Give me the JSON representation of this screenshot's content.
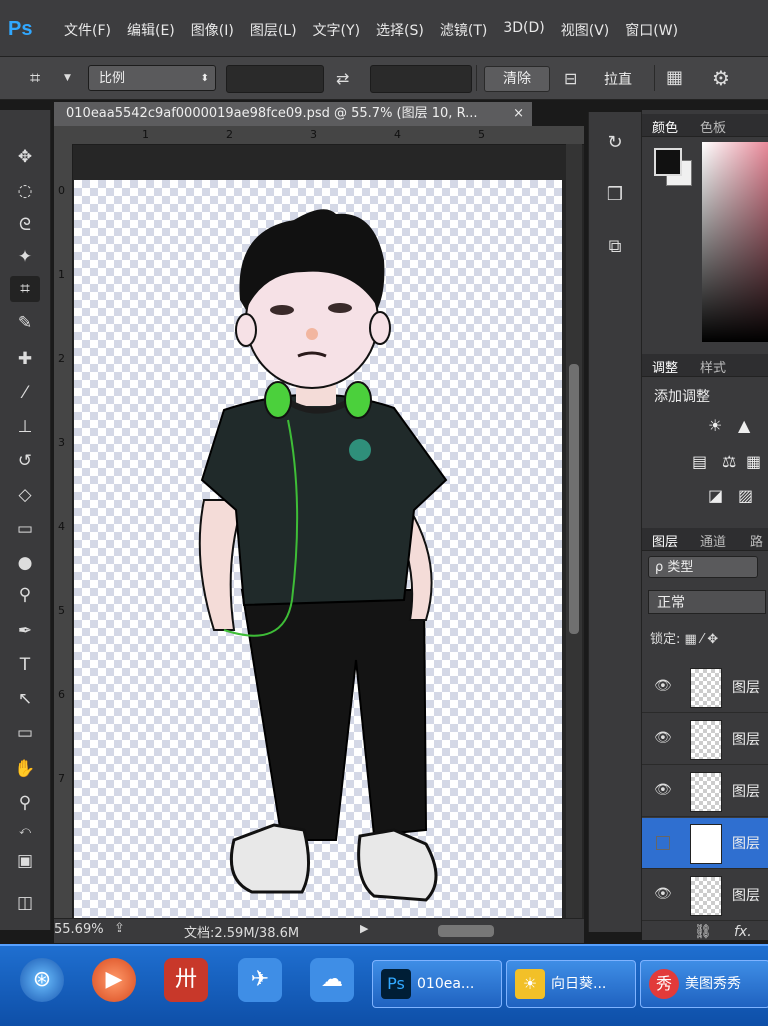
{
  "app": {
    "logo": "Ps"
  },
  "menu": [
    "文件(F)",
    "编辑(E)",
    "图像(I)",
    "图层(L)",
    "文字(Y)",
    "选择(S)",
    "滤镜(T)",
    "3D(D)",
    "视图(V)",
    "窗口(W)"
  ],
  "options": {
    "ratio_label": "比例",
    "clear_label": "清除",
    "straighten_label": "拉直",
    "icons": [
      "crop-icon",
      "swap-icon",
      "straighten-icon",
      "grid-overlay-icon",
      "gear-icon"
    ]
  },
  "document": {
    "tab_title": "010eaa5542c9af0000019ae98fce09.psd @ 55.7% (图层 10, R...",
    "close_glyph": "×",
    "ruler_h": [
      "1",
      "2",
      "3",
      "4",
      "5"
    ],
    "ruler_v": [
      "0",
      "1",
      "2",
      "3",
      "4",
      "5",
      "6",
      "7"
    ]
  },
  "status": {
    "zoom": "55.69%",
    "doc_size": "文档:2.59M/38.6M"
  },
  "panels": {
    "color_tabs": [
      "颜色",
      "色板"
    ],
    "adjust_tabs": [
      "调整",
      "样式"
    ],
    "add_adjustment": "添加调整",
    "layers_tabs": [
      "图层",
      "通道",
      "路"
    ],
    "kind_filter": "ρ 类型",
    "blend_mode": "正常",
    "lock_label": "锁定:",
    "layers": [
      {
        "name": "图层",
        "visible": true,
        "selected": false
      },
      {
        "name": "图层",
        "visible": true,
        "selected": false
      },
      {
        "name": "图层",
        "visible": true,
        "selected": false
      },
      {
        "name": "图层",
        "visible": false,
        "selected": true
      },
      {
        "name": "图层",
        "visible": true,
        "selected": false
      }
    ],
    "footer_icons": [
      "link-icon",
      "fx-icon"
    ],
    "footer_fx": "fx."
  },
  "taskbar": {
    "tasks": [
      {
        "label": "010ea...",
        "icon": "Ps"
      },
      {
        "label": "向日葵...",
        "icon": "☀"
      },
      {
        "label": "美图秀秀",
        "icon": "秀"
      }
    ]
  },
  "colors": {
    "accent_blue": "#31a8ff",
    "selected_layer": "#2f6fd0",
    "taskbar": "#1f6fd0"
  }
}
